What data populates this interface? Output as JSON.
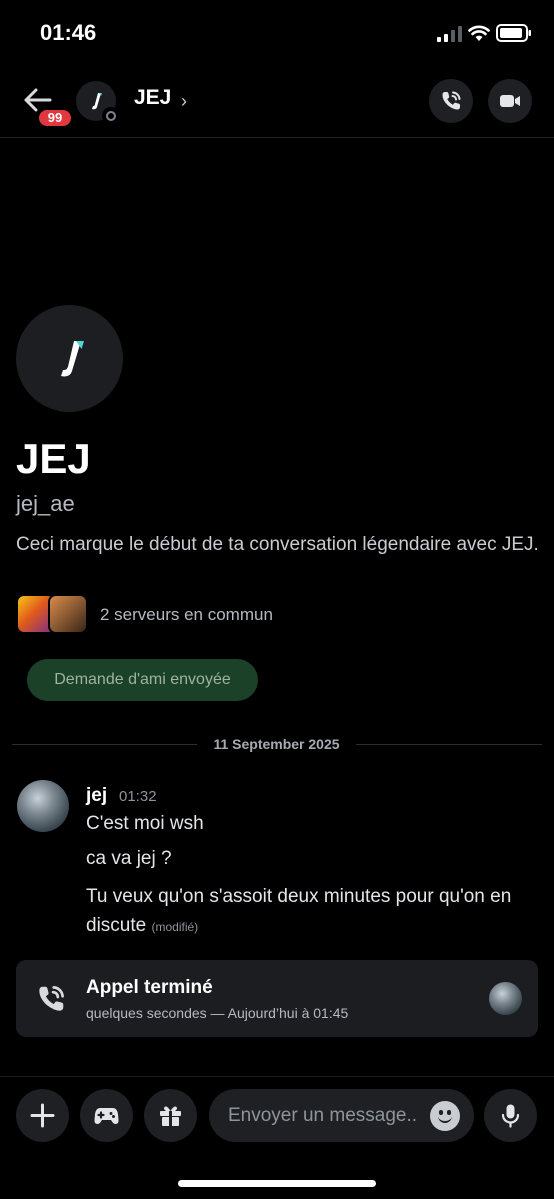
{
  "status_bar": {
    "time": "01:46"
  },
  "header": {
    "notification_count": "99",
    "contact_name": "JEJ",
    "chevron": "›",
    "icons": [
      "back-arrow-icon",
      "phone-call-icon",
      "video-camera-icon",
      "chevron-right-icon"
    ]
  },
  "profile": {
    "name": "JEJ",
    "username": "jej_ae",
    "intro": "Ceci marque le début de ta conversation légendaire avec JEJ.",
    "servers_text": "2 serveurs en commun",
    "friend_request_label": "Demande d'ami envoyée"
  },
  "divider": {
    "date": "11 September 2025"
  },
  "message": {
    "author": "jej",
    "time": "01:32",
    "lines": [
      "C'est moi wsh",
      "ca va jej ?",
      "Tu veux qu'on s'assoit deux minutes pour qu'on en discute"
    ],
    "edited_label": "(modifié)"
  },
  "call_card": {
    "title": "Appel terminé",
    "subtitle": "quelques secondes — Aujourd’hui à 01:45"
  },
  "input": {
    "placeholder": "Envoyer un message..",
    "icons": [
      "plus-icon",
      "gamepad-icon",
      "gift-icon",
      "emoji-icon",
      "microphone-icon"
    ]
  },
  "colors": {
    "background": "#000000",
    "badge": "#e0383e",
    "friend_button": "#1b4129",
    "card": "#1c1d21"
  }
}
